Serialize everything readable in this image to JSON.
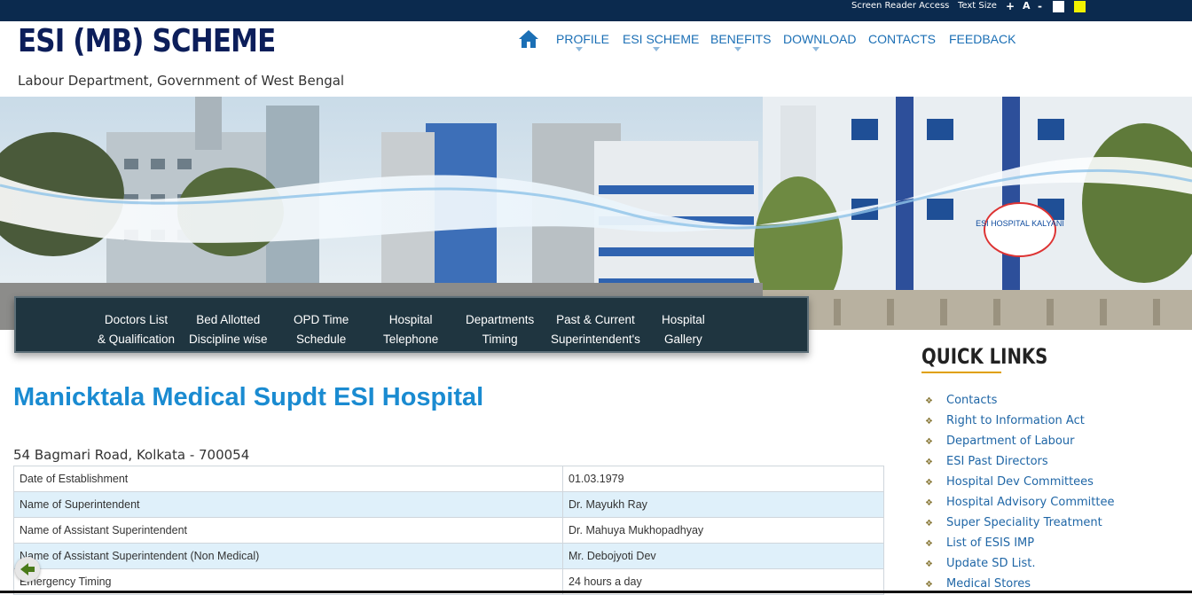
{
  "topbar": {
    "screen_reader": "Screen Reader Access",
    "text_size": "Text Size",
    "increase": "+",
    "normal": "A",
    "decrease": "-"
  },
  "header": {
    "logo": "ESI (MB) SCHEME",
    "subtitle": "Labour Department, Government of West Bengal"
  },
  "nav": {
    "items": [
      "PROFILE",
      "ESI SCHEME",
      "BENEFITS",
      "DOWNLOAD",
      "CONTACTS",
      "FEEDBACK"
    ]
  },
  "banner": {
    "signage": "ESI HOSPITAL KALYANI"
  },
  "subnav": {
    "items": [
      {
        "line1": "Doctors List",
        "line2": "& Qualification"
      },
      {
        "line1": "Bed Allotted",
        "line2": "Discipline wise"
      },
      {
        "line1": "OPD Time",
        "line2": "Schedule"
      },
      {
        "line1": "Hospital",
        "line2": "Telephone"
      },
      {
        "line1": "Departments",
        "line2": "Timing"
      },
      {
        "line1": "Past & Current",
        "line2": "Superintendent's"
      },
      {
        "line1": "Hospital",
        "line2": "Gallery"
      }
    ]
  },
  "main": {
    "title": "Manicktala Medical Supdt ESI Hospital",
    "address": "54 Bagmari Road, Kolkata - 700054",
    "rows": [
      {
        "label": "Date of Establishment",
        "value": "01.03.1979"
      },
      {
        "label": "Name of Superintendent",
        "value": "Dr. Mayukh Ray"
      },
      {
        "label": "Name of Assistant Superintendent",
        "value": "Dr. Mahuya Mukhopadhyay"
      },
      {
        "label": "Name of Assistant Superintendent (Non Medical)",
        "value": "Mr. Debojyoti Dev"
      },
      {
        "label": "Emergency Timing",
        "value": "24 hours a day"
      }
    ]
  },
  "quick_links": {
    "title": "QUICK LINKS",
    "items": [
      "Contacts",
      "Right to Information Act",
      "Department of Labour",
      "ESI Past Directors",
      "Hospital Dev Committees",
      "Hospital Advisory Committee",
      "Super Speciality Treatment",
      "List of ESIS IMP",
      "Update SD List.",
      "Medical Stores"
    ]
  },
  "colors": {
    "topbar": "#0b2a4e",
    "logo": "#0c1e5a",
    "nav_link": "#1b6fb5",
    "title": "#1a8bd1",
    "subnav_bg": "#1f3540",
    "row_alt": "#dff0fa",
    "link": "#1f66a6"
  }
}
